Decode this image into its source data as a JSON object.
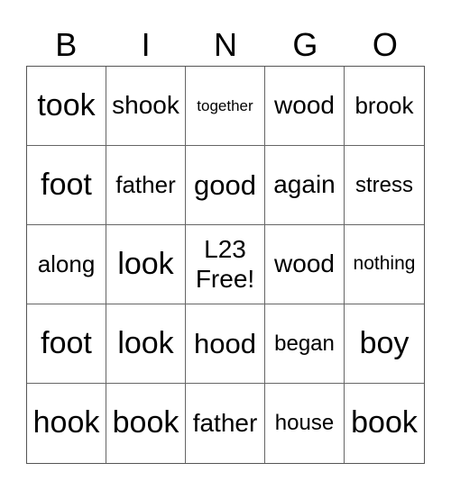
{
  "header": [
    "B",
    "I",
    "N",
    "G",
    "O"
  ],
  "cells": [
    "took",
    "shook",
    "together",
    "wood",
    "brook",
    "foot",
    "father",
    "good",
    "again",
    "stress",
    "along",
    "look",
    "L23\nFree!",
    "wood",
    "nothing",
    "foot",
    "look",
    "hood",
    "began",
    "boy",
    "hook",
    "book",
    "father",
    "house",
    "book"
  ]
}
